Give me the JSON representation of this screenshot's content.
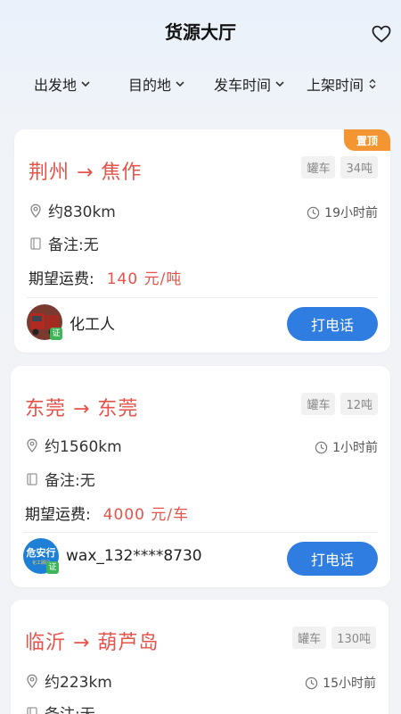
{
  "header": {
    "title": "货源大厅",
    "favorite_icon": "heart-icon"
  },
  "filters": [
    {
      "label": "出发地",
      "icon": "chevron-down-icon"
    },
    {
      "label": "目的地",
      "icon": "chevron-down-icon"
    },
    {
      "label": "发车时间",
      "icon": "chevron-down-icon"
    },
    {
      "label": "上架时间",
      "icon": "sort-icon"
    }
  ],
  "listings": [
    {
      "pinned_label": "置顶",
      "route": "荆州 → 焦作",
      "vehicle_type": "罐车",
      "weight": "34吨",
      "distance": "约830km",
      "posted": "19小时前",
      "note": "备注:无",
      "price_label": "期望运费:",
      "price_value": "140 元/吨",
      "user_name": "化工人",
      "badge": "证",
      "call_label": "打电话"
    },
    {
      "route": "东莞 → 东莞",
      "vehicle_type": "罐车",
      "weight": "12吨",
      "distance": "约1560km",
      "posted": "1小时前",
      "note": "备注:无",
      "price_label": "期望运费:",
      "price_value": "4000 元/车",
      "user_name": "wax_132****8730",
      "avatar_text": "危安行",
      "avatar_subtext": "化工顾问",
      "badge": "证",
      "call_label": "打电话"
    },
    {
      "route": "临沂 → 葫芦岛",
      "vehicle_type": "罐车",
      "weight": "130吨",
      "distance": "约223km",
      "posted": "15小时前",
      "note": "备注:无"
    }
  ],
  "colors": {
    "accent": "#e5534b",
    "button": "#2f7de1",
    "pin": "#f39531"
  }
}
